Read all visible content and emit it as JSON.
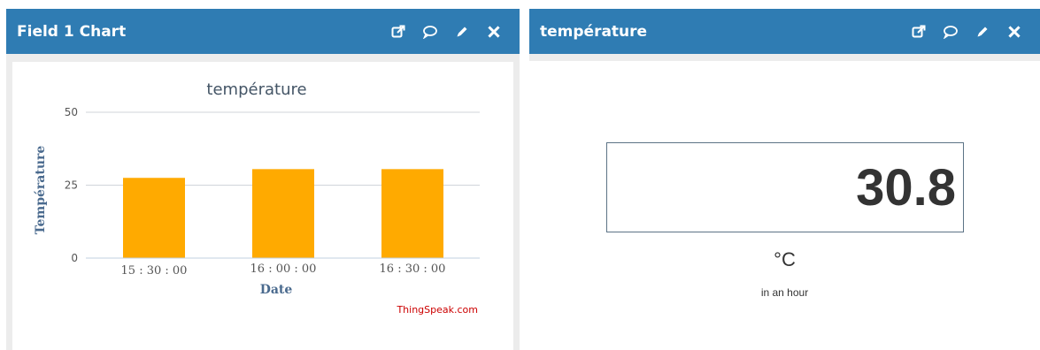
{
  "left_panel": {
    "title": "Field 1 Chart",
    "icons": [
      "external-link-icon",
      "comment-icon",
      "pencil-icon",
      "close-icon"
    ]
  },
  "right_panel": {
    "title": "température",
    "icons": [
      "external-link-icon",
      "comment-icon",
      "pencil-icon",
      "close-icon"
    ],
    "value": "30.8",
    "unit": "°C",
    "note": "in an hour"
  },
  "colors": {
    "header": "#2f7cb3",
    "bar": "#ffaa00",
    "credit": "#cc0000"
  },
  "chart_data": {
    "type": "bar",
    "title": "température",
    "xlabel": "Date",
    "ylabel": "Température",
    "categories": [
      "15 : 30 : 00",
      "16 : 00 : 00",
      "16 : 30 : 00"
    ],
    "values": [
      27.5,
      30.5,
      30.5
    ],
    "ylim": [
      0,
      50
    ],
    "yticks": [
      0,
      25,
      50
    ],
    "grid": true,
    "credit": "ThingSpeak.com"
  }
}
